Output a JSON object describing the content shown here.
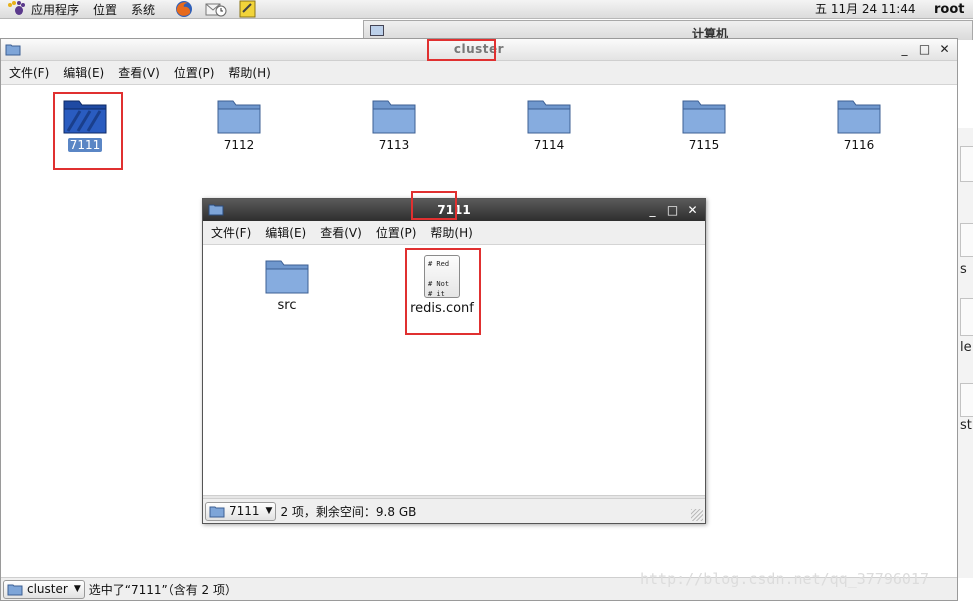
{
  "panel": {
    "menus": [
      "应用程序",
      "位置",
      "系统"
    ],
    "clock": "五 11月 24 11:44",
    "user": "root"
  },
  "bg_window": {
    "title": "计算机"
  },
  "right_edge": {
    "fragments": [
      "s",
      "le",
      "st"
    ]
  },
  "main_window": {
    "title": "cluster",
    "menu": [
      "文件(F)",
      "编辑(E)",
      "查看(V)",
      "位置(P)",
      "帮助(H)"
    ],
    "folders": [
      "7111",
      "7112",
      "7113",
      "7114",
      "7115",
      "7116"
    ],
    "selected_folder": "7111",
    "status": {
      "location": "cluster",
      "text": "选中了“7111”（含有 2 项）"
    }
  },
  "inner_window": {
    "title": "7111",
    "menu": [
      "文件(F)",
      "编辑(E)",
      "查看(V)",
      "位置(P)",
      "帮助(H)"
    ],
    "items": [
      {
        "name": "src",
        "type": "folder"
      },
      {
        "name": "redis.conf",
        "type": "file",
        "preview": [
          "# Red",
          "",
          "# Not",
          "# it"
        ]
      }
    ],
    "status": {
      "location": "7111",
      "text": "2 项，剩余空间：9.8 GB"
    }
  },
  "watermark": "http://blog.csdn.net/qq_37796017",
  "colors": {
    "folder_light": "#7ea5d8",
    "folder_selected": "#1f4aa3",
    "highlight": "#e03030",
    "selection": "#5a86c5"
  }
}
